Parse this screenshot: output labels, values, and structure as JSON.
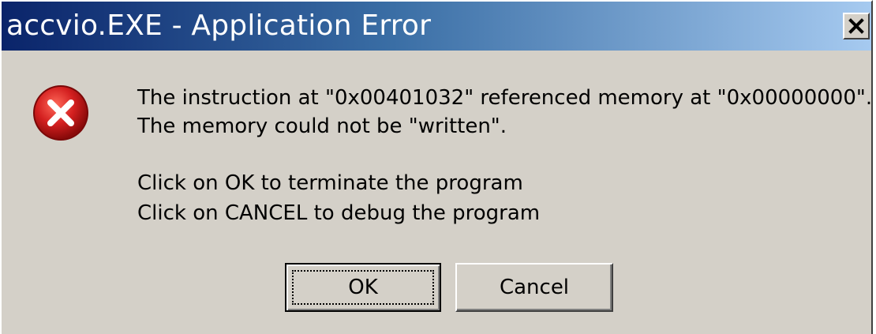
{
  "window": {
    "title": "accvio.EXE - Application Error",
    "close_label": "X"
  },
  "message": {
    "line1": "The instruction at \"0x00401032\" referenced memory at \"0x00000000\".",
    "line2": "The memory could not be \"written\".",
    "line3": "Click on OK to terminate the program",
    "line4": "Click on CANCEL to debug the program"
  },
  "icon": "error-icon",
  "buttons": {
    "ok_label": "OK",
    "cancel_label": "Cancel"
  },
  "colors": {
    "titlebar_start": "#0a246a",
    "titlebar_end": "#a6caf0",
    "dialog_bg": "#d4d0c8",
    "error_red": "#d42020"
  }
}
